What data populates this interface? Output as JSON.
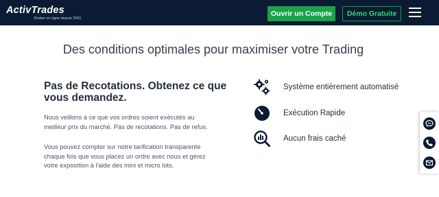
{
  "header": {
    "logo_text": "ActivTrades",
    "logo_tagline": "Broker en ligne depuis 2001",
    "open_account_label": "Ouvrir un Compte",
    "demo_label": "Démo Gratuite",
    "menu_icon": "hamburger-icon"
  },
  "main": {
    "title": "Des conditions optimales pour maximiser votre Trading",
    "left": {
      "title": "Pas de Recotations. Obtenez ce que vous demandez.",
      "paragraph1": "Nous veillons à ce que vos ordres soient exécutés au meilleur prix du marché. Pas de recotations. Pas de refus.",
      "paragraph2": "Vous pouvez compter sur notre tarification transparente chaque fois que vous placez un ordre avec nous et gérez votre exposition à l'aide des mini et micro lots."
    },
    "features": [
      {
        "icon": "gears-icon",
        "label": "Système entièrement automatisé"
      },
      {
        "icon": "stopwatch-icon",
        "label": "Exécution Rapide"
      },
      {
        "icon": "magnifier-chart-icon",
        "label": "Aucun frais caché"
      }
    ]
  },
  "side_widget": {
    "items": [
      "chat-icon",
      "phone-icon",
      "email-icon"
    ]
  },
  "colors": {
    "header_bg": "#0b1b33",
    "accent_green": "#1aa34a",
    "icon_navy": "#0b1b33"
  }
}
